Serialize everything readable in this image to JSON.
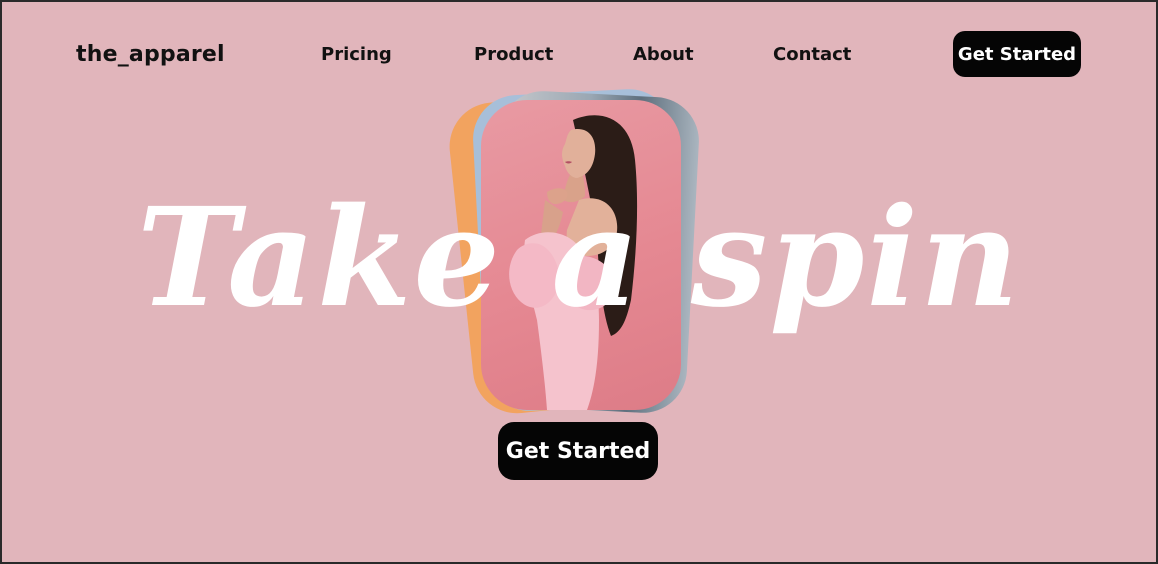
{
  "brand": {
    "name": "the_apparel"
  },
  "nav": {
    "links": [
      {
        "label": "Pricing"
      },
      {
        "label": "Product"
      },
      {
        "label": "About"
      },
      {
        "label": "Contact"
      }
    ],
    "cta_label": "Get Started"
  },
  "hero": {
    "title": "Take a spin",
    "cta_label": "Get Started"
  },
  "colors": {
    "background": "#e1b5bb",
    "button": "#050505",
    "button_text": "#ffffff",
    "hero_text": "#ffffff"
  }
}
